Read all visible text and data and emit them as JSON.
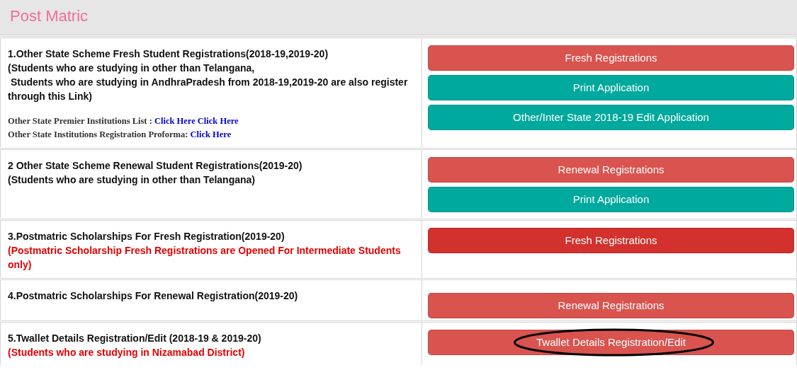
{
  "header": {
    "title": "Post Matric"
  },
  "sections": [
    {
      "title": "1.Other State Scheme Fresh Student Registrations(2018-19,2019-20)",
      "note_lines": [
        "(Students who are studying in other than Telangana,",
        " Students who are studying in AndhraPradesh from 2018-19,2019-20 are also register through this Link)"
      ],
      "note_warning": false,
      "link_lines": [
        {
          "label": "Other State Premier Institutions List :",
          "links": [
            "Click Here",
            "Click Here"
          ]
        },
        {
          "label": "Other State Institutions Registration Proforma:",
          "links": [
            "Click Here"
          ]
        }
      ],
      "buttons": [
        {
          "label": "Fresh Registrations",
          "kind": "danger",
          "circled": false
        },
        {
          "label": "Print Application",
          "kind": "teal",
          "circled": false
        },
        {
          "label": "Other/Inter State 2018-19 Edit Application",
          "kind": "teal",
          "circled": false
        }
      ]
    },
    {
      "title": "2 Other State Scheme Renewal Student Registrations(2019-20)",
      "note_lines": [
        "(Students who are studying in other than Telangana)"
      ],
      "note_warning": false,
      "buttons": [
        {
          "label": "Renewal Registrations",
          "kind": "danger",
          "circled": false
        },
        {
          "label": "Print Application",
          "kind": "teal",
          "circled": false
        }
      ]
    },
    {
      "title": "3.Postmatric Scholarships For Fresh Registration(2019-20)",
      "note_lines": [
        "(Postmatric Scholarship Fresh Registrations are Opened For Intermediate Students only)"
      ],
      "note_warning": true,
      "buttons": [
        {
          "label": "Fresh Registrations",
          "kind": "strong",
          "circled": false
        }
      ]
    },
    {
      "title": "4.Postmatric Scholarships For Renewal Registration(2019-20)",
      "buttons": [
        {
          "label": "Renewal Registrations",
          "kind": "danger",
          "circled": false
        }
      ]
    },
    {
      "title": "5.Twallet Details Registration/Edit (2018-19 & 2019-20)",
      "note_lines": [
        "(Students who are studying in Nizamabad District)"
      ],
      "note_warning": true,
      "buttons": [
        {
          "label": "Twallet Details Registration/Edit",
          "kind": "danger",
          "circled": true
        }
      ]
    }
  ]
}
